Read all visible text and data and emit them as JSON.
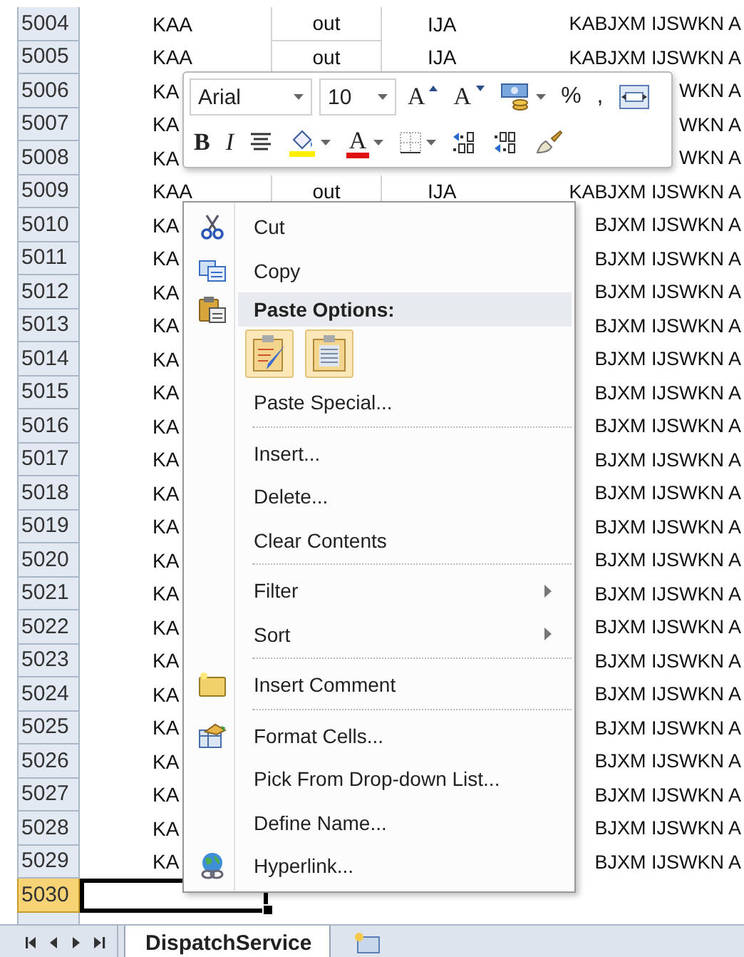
{
  "sheet": {
    "rows": [
      {
        "number": "5004",
        "a": "KAA",
        "b": "out",
        "c": "IJA",
        "d": "KABJXM IJSWKN A",
        "selected": false
      },
      {
        "number": "5005",
        "a": "KAA",
        "b": "out",
        "c": "IJA",
        "d": "KABJXM IJSWKN A",
        "selected": false
      },
      {
        "number": "5006",
        "a": "KA",
        "d": "WKN A",
        "selected": false
      },
      {
        "number": "5007",
        "a": "KA",
        "d": "WKN A",
        "selected": false
      },
      {
        "number": "5008",
        "a": "KA",
        "d": "WKN A",
        "selected": false
      },
      {
        "number": "5009",
        "a": "KAA",
        "b": "out",
        "c": "IJA",
        "d": "KABJXM IJSWKN A",
        "selected": false
      },
      {
        "number": "5010",
        "a": "KA",
        "d": "BJXM IJSWKN A",
        "selected": false
      },
      {
        "number": "5011",
        "a": "KA",
        "d": "BJXM IJSWKN A",
        "selected": false
      },
      {
        "number": "5012",
        "a": "KA",
        "d": "BJXM IJSWKN A",
        "selected": false
      },
      {
        "number": "5013",
        "a": "KA",
        "d": "BJXM IJSWKN A",
        "selected": false
      },
      {
        "number": "5014",
        "a": "KA",
        "d": "BJXM IJSWKN A",
        "selected": false
      },
      {
        "number": "5015",
        "a": "KA",
        "d": "BJXM IJSWKN A",
        "selected": false
      },
      {
        "number": "5016",
        "a": "KA",
        "d": "BJXM IJSWKN A",
        "selected": false
      },
      {
        "number": "5017",
        "a": "KA",
        "d": "BJXM IJSWKN A",
        "selected": false
      },
      {
        "number": "5018",
        "a": "KA",
        "d": "BJXM IJSWKN A",
        "selected": false
      },
      {
        "number": "5019",
        "a": "KA",
        "d": "BJXM IJSWKN A",
        "selected": false
      },
      {
        "number": "5020",
        "a": "KA",
        "d": "BJXM IJSWKN A",
        "selected": false
      },
      {
        "number": "5021",
        "a": "KA",
        "d": "BJXM IJSWKN A",
        "selected": false
      },
      {
        "number": "5022",
        "a": "KA",
        "d": "BJXM IJSWKN A",
        "selected": false
      },
      {
        "number": "5023",
        "a": "KA",
        "d": "BJXM IJSWKN A",
        "selected": false
      },
      {
        "number": "5024",
        "a": "KA",
        "d": "BJXM IJSWKN A",
        "selected": false
      },
      {
        "number": "5025",
        "a": "KA",
        "d": "BJXM IJSWKN A",
        "selected": false
      },
      {
        "number": "5026",
        "a": "KA",
        "d": "BJXM IJSWKN A",
        "selected": false
      },
      {
        "number": "5027",
        "a": "KA",
        "d": "BJXM IJSWKN A",
        "selected": false
      },
      {
        "number": "5028",
        "a": "KA",
        "d": "BJXM IJSWKN A",
        "selected": false
      },
      {
        "number": "5029",
        "a": "KA",
        "d": "BJXM IJSWKN A",
        "selected": false
      },
      {
        "number": "5030",
        "selected": true
      }
    ]
  },
  "mini_toolbar": {
    "font": "Arial",
    "size": "10",
    "grow_font": "A",
    "shrink_font": "A",
    "percent": "%",
    "comma": ",",
    "bold": "B",
    "italic": "I",
    "font_color": "A"
  },
  "context_menu": {
    "items": [
      {
        "kind": "command",
        "label": "Cut",
        "submenu": false
      },
      {
        "kind": "command",
        "label": "Copy",
        "submenu": false
      },
      {
        "kind": "header",
        "label": "Paste Options:"
      },
      {
        "kind": "paste-icons"
      },
      {
        "kind": "command",
        "label": "Paste Special...",
        "submenu": false
      },
      {
        "kind": "separator"
      },
      {
        "kind": "command",
        "label": "Insert...",
        "submenu": false
      },
      {
        "kind": "command",
        "label": "Delete...",
        "submenu": false
      },
      {
        "kind": "command",
        "label": "Clear Contents",
        "submenu": false
      },
      {
        "kind": "separator"
      },
      {
        "kind": "command",
        "label": "Filter",
        "submenu": true
      },
      {
        "kind": "command",
        "label": "Sort",
        "submenu": true
      },
      {
        "kind": "separator"
      },
      {
        "kind": "command",
        "label": "Insert Comment",
        "submenu": false
      },
      {
        "kind": "separator"
      },
      {
        "kind": "command",
        "label": "Format Cells...",
        "submenu": false
      },
      {
        "kind": "command",
        "label": "Pick From Drop-down List...",
        "submenu": false
      },
      {
        "kind": "command",
        "label": "Define Name...",
        "submenu": false
      },
      {
        "kind": "command",
        "label": "Hyperlink...",
        "submenu": false
      }
    ]
  },
  "sheet_tabs": [
    {
      "label": "DispatchService",
      "selected": true
    }
  ]
}
